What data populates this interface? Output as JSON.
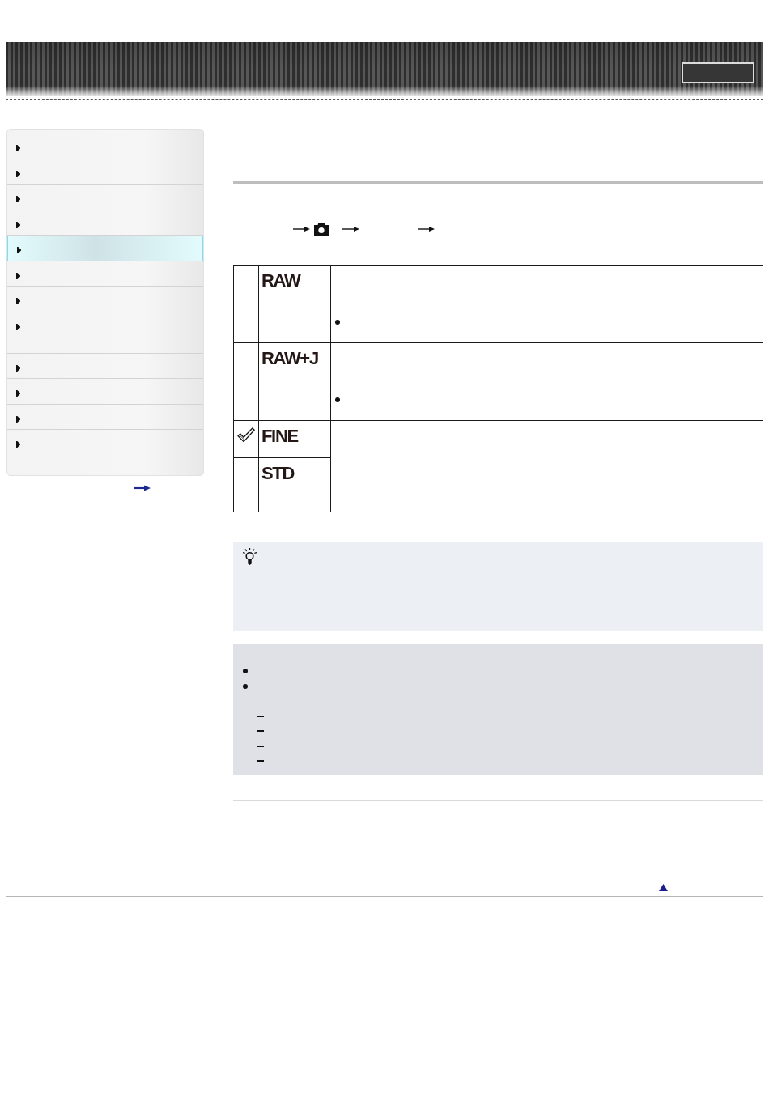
{
  "sidebar": {
    "items": [
      {
        "kind": "single",
        "selected": false
      },
      {
        "kind": "single",
        "selected": false
      },
      {
        "kind": "single",
        "selected": false
      },
      {
        "kind": "single",
        "selected": false
      },
      {
        "kind": "single",
        "selected": true
      },
      {
        "kind": "single",
        "selected": false
      },
      {
        "kind": "single",
        "selected": false
      },
      {
        "kind": "tall",
        "selected": false
      },
      {
        "kind": "single",
        "selected": false
      },
      {
        "kind": "single",
        "selected": false
      },
      {
        "kind": "single",
        "selected": false
      },
      {
        "kind": "tall",
        "selected": false
      }
    ]
  },
  "table": {
    "rows": [
      {
        "options": [
          {
            "label": "RAW",
            "checked": false
          }
        ],
        "notes": [
          {
            "kind": "bullet"
          }
        ]
      },
      {
        "options": [
          {
            "label": "RAW+J",
            "checked": false
          }
        ],
        "notes": [
          {
            "kind": "bullet"
          }
        ]
      },
      {
        "options": [
          {
            "label": "FINE",
            "checked": true
          },
          {
            "label": "STD",
            "checked": false
          }
        ]
      }
    ]
  },
  "note_box": {
    "items": [
      {
        "kind": "bullet"
      },
      {
        "kind": "bullet",
        "children": [
          {
            "kind": "dash"
          },
          {
            "kind": "dash"
          },
          {
            "kind": "dash"
          },
          {
            "kind": "dash"
          }
        ]
      }
    ]
  }
}
